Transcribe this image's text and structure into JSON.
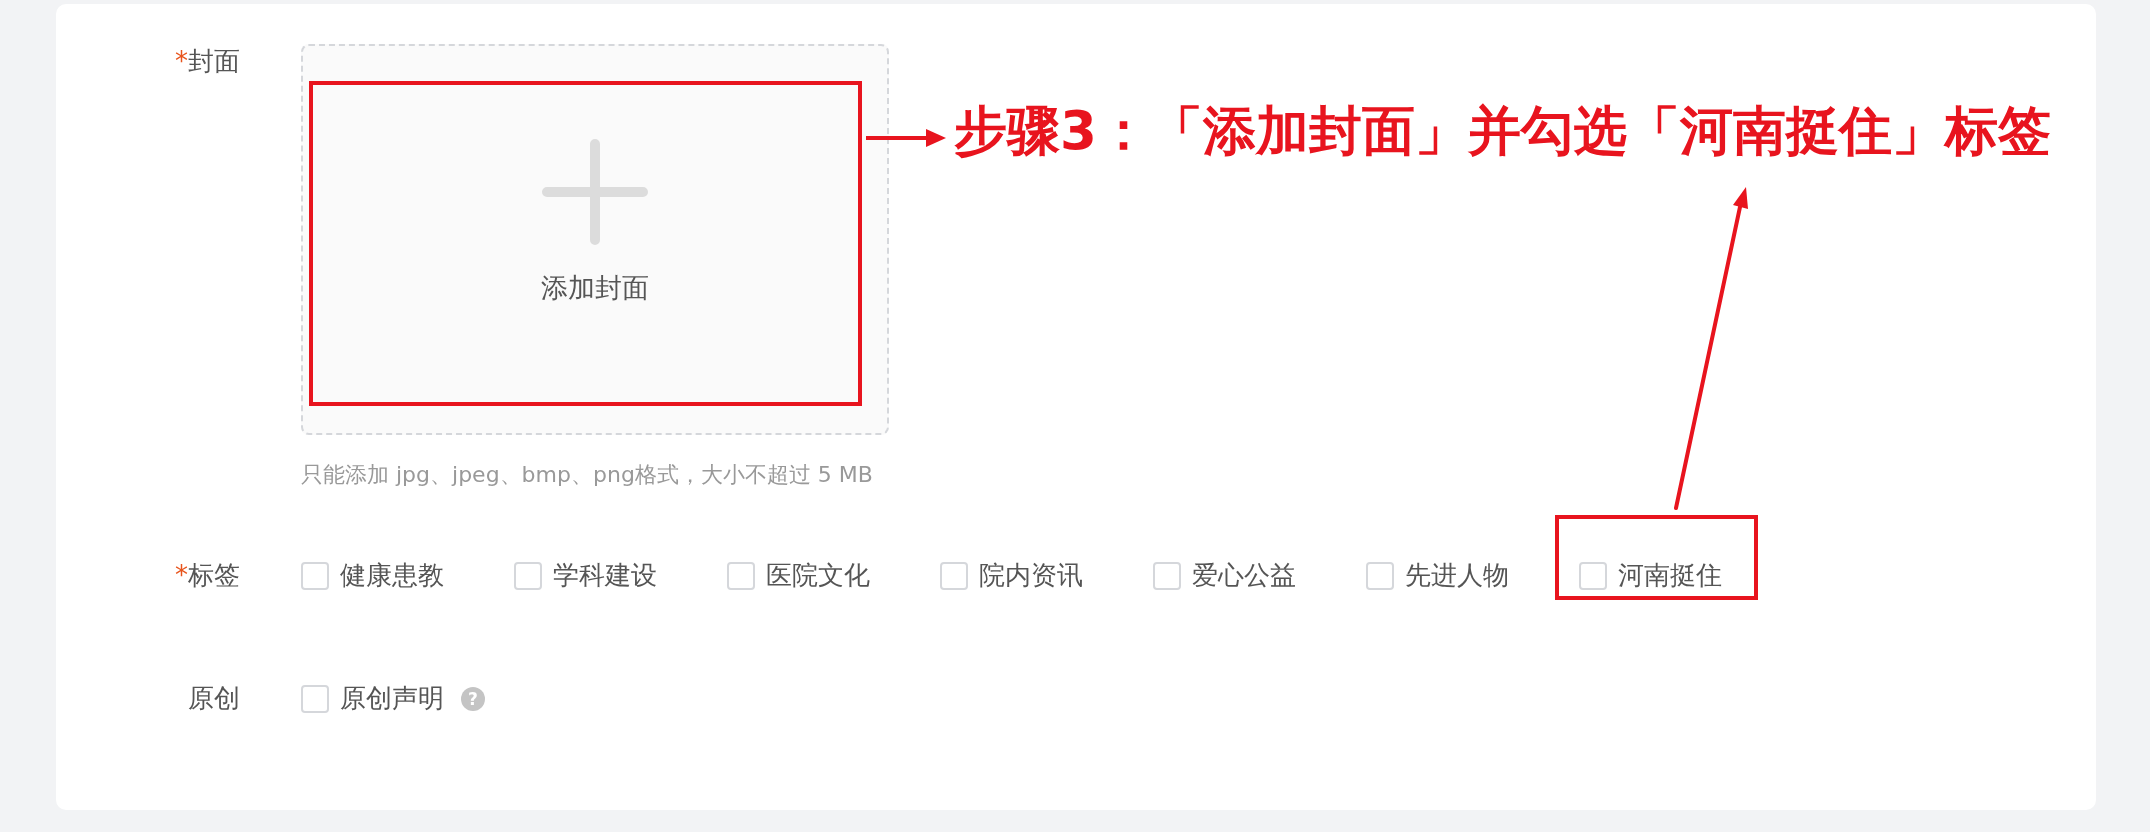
{
  "form": {
    "rows": [
      {
        "kind": "upload",
        "label": "封面",
        "required_mark": "*",
        "upload_label": "添加封面",
        "highlighted": true,
        "hint": "只能添加 jpg、jpeg、bmp、png格式，大小不超过 5 MB"
      },
      {
        "kind": "checks",
        "label": "标签",
        "required_mark": "*",
        "options": [
          {
            "label": "健康患教",
            "checked": false,
            "highlighted": false
          },
          {
            "label": "学科建设",
            "checked": false,
            "highlighted": false
          },
          {
            "label": "医院文化",
            "checked": false,
            "highlighted": false
          },
          {
            "label": "院内资讯",
            "checked": false,
            "highlighted": false
          },
          {
            "label": "爱心公益",
            "checked": false,
            "highlighted": false
          },
          {
            "label": "先进人物",
            "checked": false,
            "highlighted": false
          },
          {
            "label": "河南挺住",
            "checked": false,
            "highlighted": true
          }
        ]
      },
      {
        "kind": "checks",
        "label": "原创",
        "options": [
          {
            "label": "原创声明",
            "checked": false,
            "highlighted": false,
            "help": "?"
          }
        ]
      }
    ]
  },
  "annotation": {
    "text": "步骤3：「添加封面」并勾选「河南挺住」标签"
  }
}
